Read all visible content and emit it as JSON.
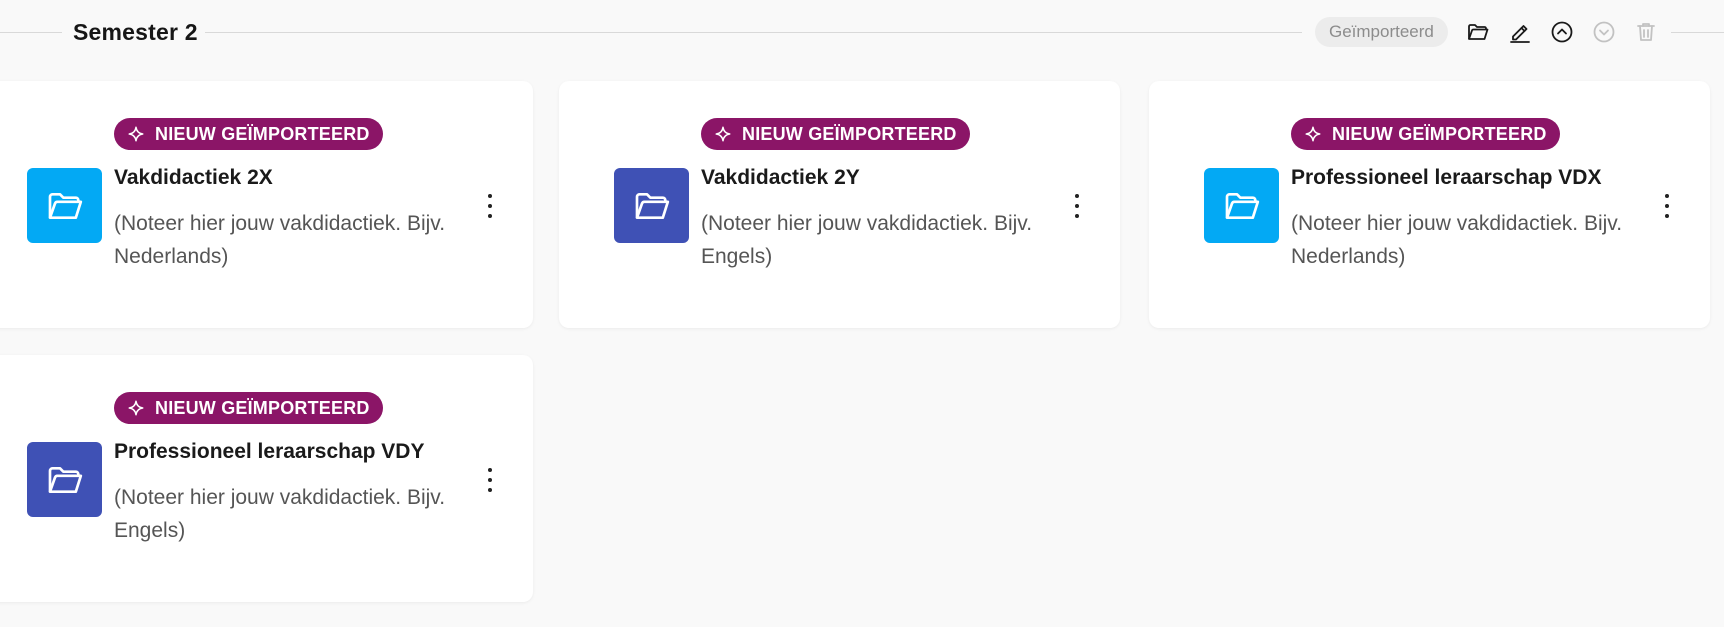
{
  "section": {
    "title": "Semester 2",
    "status_chip": "Geïmporteerd",
    "actions": [
      {
        "name": "open-folder",
        "icon": "folder-open-icon"
      },
      {
        "name": "edit",
        "icon": "pencil-icon"
      },
      {
        "name": "move-up",
        "icon": "chevron-up-circle-icon"
      },
      {
        "name": "move-down",
        "icon": "chevron-down-circle-icon",
        "disabled": true
      },
      {
        "name": "delete",
        "icon": "trash-icon",
        "disabled": true
      }
    ]
  },
  "colors": {
    "badge_bg": "#8b1567",
    "folder_light_blue": "#03a9f4",
    "folder_indigo": "#3f51b5",
    "page_bg": "#f9f9f9"
  },
  "cards": [
    {
      "badge": "NIEUW GEÏMPORTEERD",
      "title": "Vakdidactiek 2X",
      "description": "(Noteer hier jouw vakdidactiek. Bijv. Nederlands)",
      "folder_color": "light-blue",
      "icon": "folder-open-icon"
    },
    {
      "badge": "NIEUW GEÏMPORTEERD",
      "title": "Vakdidactiek 2Y",
      "description": "(Noteer hier jouw vakdidactiek. Bijv. Engels)",
      "folder_color": "indigo",
      "icon": "folder-open-icon"
    },
    {
      "badge": "NIEUW GEÏMPORTEERD",
      "title": "Professioneel leraarschap VDX",
      "description": "(Noteer hier jouw vakdidactiek. Bijv. Nederlands)",
      "folder_color": "light-blue",
      "icon": "folder-open-icon"
    },
    {
      "badge": "NIEUW GEÏMPORTEERD",
      "title": "Professioneel leraarschap VDY",
      "description": "(Noteer hier jouw vakdidactiek. Bijv. Engels)",
      "folder_color": "indigo",
      "icon": "folder-open-icon"
    }
  ]
}
